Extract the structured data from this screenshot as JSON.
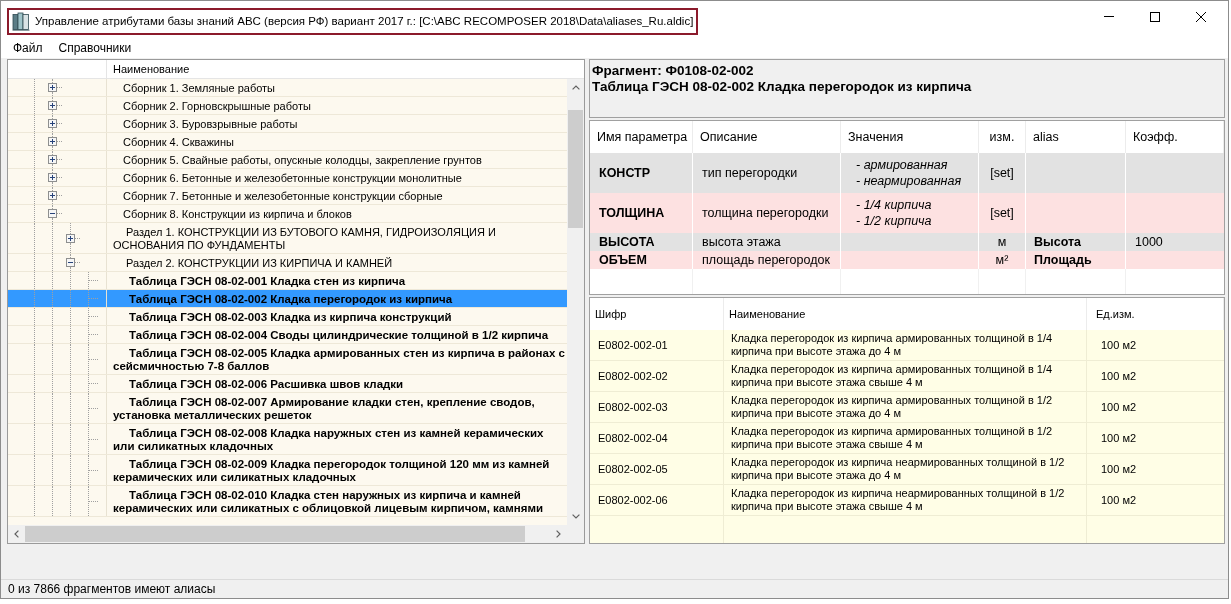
{
  "window": {
    "title": "Управление атрибутами базы знаний ABC (версия РФ) вариант 2017 г.: [C:\\ABC RECOMPOSER 2018\\Data\\aliases_Ru.aldic]"
  },
  "menu": [
    {
      "label": "Файл"
    },
    {
      "label": "Справочники"
    }
  ],
  "tree": {
    "column": "Наименование",
    "items": [
      {
        "kind": "group",
        "label": "Сборник 1. Земляные работы",
        "expanded": false,
        "selected": false
      },
      {
        "kind": "group",
        "label": "Сборник 2. Горновскрышные работы",
        "expanded": false,
        "selected": false
      },
      {
        "kind": "group",
        "label": "Сборник 3. Буровзрывные работы",
        "expanded": false,
        "selected": false
      },
      {
        "kind": "group",
        "label": "Сборник 4. Скважины",
        "expanded": false,
        "selected": false
      },
      {
        "kind": "group",
        "label": "Сборник 5. Свайные работы, опускные колодцы, закрепление грунтов",
        "expanded": false,
        "selected": false
      },
      {
        "kind": "group",
        "label": "Сборник 6. Бетонные и железобетонные конструкции монолитные",
        "expanded": false,
        "selected": false
      },
      {
        "kind": "group",
        "label": "Сборник 7. Бетонные и железобетонные конструкции сборные",
        "expanded": false,
        "selected": false
      },
      {
        "kind": "group",
        "label": "Сборник 8. Конструкции из кирпича и блоков",
        "expanded": true,
        "selected": false,
        "children": [
          {
            "kind": "group",
            "label": "Раздел 1. КОНСТРУКЦИИ ИЗ БУТОВОГО КАМНЯ, ГИДРОИЗОЛЯЦИЯ И ОСНОВАНИЯ ПО ФУНДАМЕНТЫ",
            "expanded": false,
            "selected": false
          },
          {
            "kind": "group",
            "label": "Раздел 2. КОНСТРУКЦИИ ИЗ КИРПИЧА И КАМНЕЙ",
            "expanded": true,
            "selected": false,
            "children": [
              {
                "kind": "table",
                "label": "Таблица ГЭСН 08-02-001 Кладка стен из кирпича",
                "selected": false
              },
              {
                "kind": "table",
                "label": "Таблица ГЭСН 08-02-002 Кладка перегородок из кирпича",
                "selected": true
              },
              {
                "kind": "table",
                "label": "Таблица ГЭСН 08-02-003 Кладка из кирпича конструкций",
                "selected": false
              },
              {
                "kind": "table",
                "label": "Таблица ГЭСН 08-02-004 Своды цилиндрические толщиной в 1/2 кирпича",
                "selected": false
              },
              {
                "kind": "table",
                "label": "Таблица ГЭСН 08-02-005 Кладка армированных стен из кирпича в районах с сейсмичностью 7-8 баллов",
                "selected": false
              },
              {
                "kind": "table",
                "label": "Таблица ГЭСН 08-02-006 Расшивка швов кладки",
                "selected": false
              },
              {
                "kind": "table",
                "label": "Таблица ГЭСН 08-02-007 Армирование кладки стен, крепление сводов, установка металлических решеток",
                "selected": false
              },
              {
                "kind": "table",
                "label": "Таблица ГЭСН 08-02-008 Кладка наружных стен из камней керамических или силикатных кладочных",
                "selected": false
              },
              {
                "kind": "table",
                "label": "Таблица ГЭСН 08-02-009 Кладка перегородок толщиной 120 мм из камней керамических или силикатных кладочных",
                "selected": false
              },
              {
                "kind": "table",
                "label": "Таблица ГЭСН 08-02-010 Кладка стен наружных из кирпича и камней керамических или силикатных с облицовкой лицевым кирпичом, камнями",
                "selected": false
              }
            ]
          }
        ]
      }
    ]
  },
  "fragment": {
    "heading": "Фрагмент: Ф0108-02-002",
    "title": "Таблица ГЭСН 08-02-002 Кладка перегородок из кирпича"
  },
  "parameters": {
    "columns": [
      "Имя параметра",
      "Описание",
      "Значения",
      "изм.",
      "alias",
      "Коэфф."
    ],
    "rows": [
      {
        "name": "КОНСТР",
        "description": "тип перегородки",
        "values": [
          "- армированная",
          "- неармированная"
        ],
        "unit": "[set]"
      },
      {
        "name": "ТОЛЩИНА",
        "description": "толщина перегородки",
        "values": [
          "- 1/4 кирпича",
          "- 1/2 кирпича"
        ],
        "unit": "[set]"
      },
      {
        "name": "ВЫСОТА",
        "description": "высота этажа",
        "unit": "м",
        "alias": "Высота",
        "coefficient": "1000"
      },
      {
        "name": "ОБЪЕМ",
        "description": "площадь перегородок",
        "unit": "м²",
        "alias": "Площадь"
      }
    ]
  },
  "items": {
    "columns": [
      "Шифр",
      "Наименование",
      "Ед.изм."
    ],
    "rows": [
      {
        "code": "Е0802-002-01",
        "name": "Кладка перегородок из кирпича армированных толщиной в 1/4 кирпича при высоте этажа до 4 м",
        "unit": "100 м2"
      },
      {
        "code": "Е0802-002-02",
        "name": "Кладка перегородок из кирпича армированных толщиной в 1/4 кирпича при высоте этажа свыше 4 м",
        "unit": "100 м2"
      },
      {
        "code": "Е0802-002-03",
        "name": "Кладка перегородок из кирпича армированных толщиной в 1/2 кирпича при высоте этажа до 4 м",
        "unit": "100 м2"
      },
      {
        "code": "Е0802-002-04",
        "name": "Кладка перегородок из кирпича армированных толщиной в 1/2 кирпича при высоте этажа свыше 4 м",
        "unit": "100 м2"
      },
      {
        "code": "Е0802-002-05",
        "name": "Кладка перегородок из кирпича неармированных толщиной в 1/2 кирпича при высоте этажа до 4 м",
        "unit": "100 м2"
      },
      {
        "code": "Е0802-002-06",
        "name": "Кладка перегородок из кирпича неармированных толщиной в 1/2 кирпича при высоте этажа свыше 4 м",
        "unit": "100 м2"
      }
    ]
  },
  "status_bar": "0 из 7866 фрагментов имеют алиасы"
}
